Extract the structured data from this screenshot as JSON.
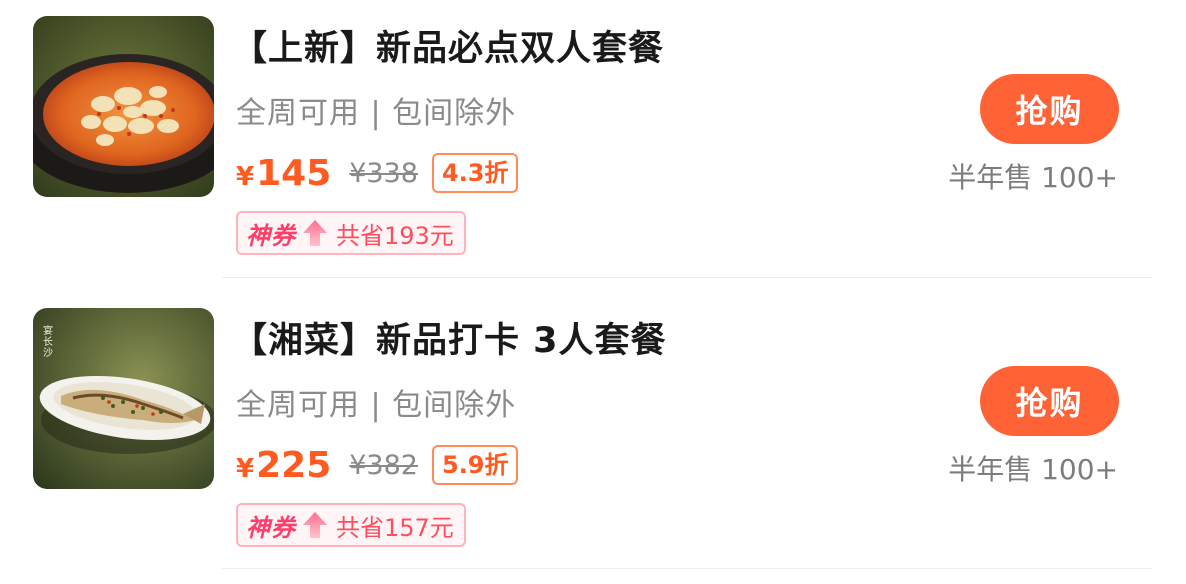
{
  "colors": {
    "accent": "#ff6235",
    "price": "#ff5a1f",
    "coupon": "#ff3d6b"
  },
  "deals": [
    {
      "title": "【上新】新品必点双人套餐",
      "subtitle": "全周可用 | 包间除外",
      "price_symbol": "¥",
      "price": "145",
      "original_price": "¥338",
      "discount": "4.3折",
      "coupon_tag": "神券",
      "coupon_text": "共省193元",
      "buy_label": "抢购",
      "sold": "半年售 100+",
      "image_icon": "food-photo-spicy-dish"
    },
    {
      "title": "【湘菜】新品打卡 3人套餐",
      "subtitle": "全周可用 | 包间除外",
      "price_symbol": "¥",
      "price": "225",
      "original_price": "¥382",
      "discount": "5.9折",
      "coupon_tag": "神券",
      "coupon_text": "共省157元",
      "buy_label": "抢购",
      "sold": "半年售 100+",
      "image_icon": "food-photo-fish-plate",
      "image_caption": "宴长沙"
    }
  ]
}
